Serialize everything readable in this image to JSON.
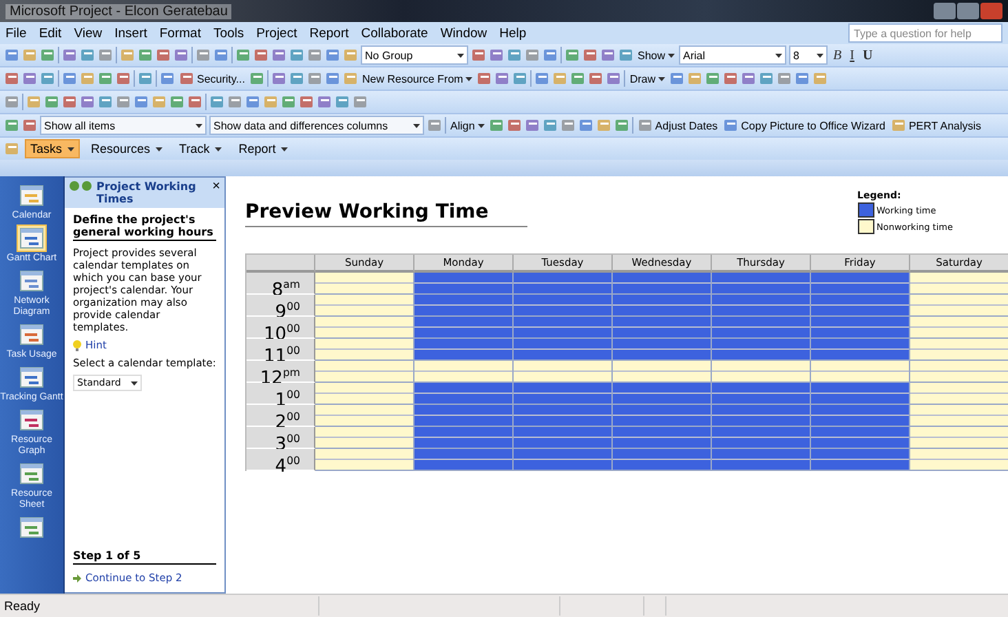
{
  "window": {
    "title": "Microsoft Project - Elcon Geratebau"
  },
  "menu": {
    "items": [
      "File",
      "Edit",
      "View",
      "Insert",
      "Format",
      "Tools",
      "Project",
      "Report",
      "Collaborate",
      "Window",
      "Help"
    ],
    "help_placeholder": "Type a question for help"
  },
  "toolbars": [
    [
      {
        "kind": "icon"
      },
      {
        "kind": "icon"
      },
      {
        "kind": "icon"
      },
      {
        "kind": "sep"
      },
      {
        "kind": "icon"
      },
      {
        "kind": "icon"
      },
      {
        "kind": "icon"
      },
      {
        "kind": "sep"
      },
      {
        "kind": "icon"
      },
      {
        "kind": "icon"
      },
      {
        "kind": "icon"
      },
      {
        "kind": "icon"
      },
      {
        "kind": "sep"
      },
      {
        "kind": "icon"
      },
      {
        "kind": "icon"
      },
      {
        "kind": "sep"
      },
      {
        "kind": "icon"
      },
      {
        "kind": "icon"
      },
      {
        "kind": "icon"
      },
      {
        "kind": "icon"
      },
      {
        "kind": "icon"
      },
      {
        "kind": "icon"
      },
      {
        "kind": "icon"
      },
      {
        "kind": "field",
        "text": "No Group"
      },
      {
        "kind": "icon"
      },
      {
        "kind": "icon"
      },
      {
        "kind": "icon"
      },
      {
        "kind": "icon"
      },
      {
        "kind": "icon"
      },
      {
        "kind": "sep"
      },
      {
        "kind": "icon"
      },
      {
        "kind": "icon"
      },
      {
        "kind": "icon"
      },
      {
        "kind": "icon"
      },
      {
        "kind": "menu",
        "text": "Show"
      },
      {
        "kind": "field",
        "text": "Arial"
      },
      {
        "kind": "small",
        "text": "8"
      },
      {
        "kind": "glyph",
        "text": "B"
      },
      {
        "kind": "glyph",
        "text": "I"
      },
      {
        "kind": "glyph",
        "text": "U"
      }
    ],
    [
      {
        "kind": "icon"
      },
      {
        "kind": "icon"
      },
      {
        "kind": "icon"
      },
      {
        "kind": "sep"
      },
      {
        "kind": "icon"
      },
      {
        "kind": "icon"
      },
      {
        "kind": "icon"
      },
      {
        "kind": "icon"
      },
      {
        "kind": "sep"
      },
      {
        "kind": "icon"
      },
      {
        "kind": "sep"
      },
      {
        "kind": "icon"
      },
      {
        "kind": "button",
        "text": "Security..."
      },
      {
        "kind": "icon"
      },
      {
        "kind": "sep"
      },
      {
        "kind": "icon"
      },
      {
        "kind": "icon"
      },
      {
        "kind": "icon"
      },
      {
        "kind": "icon"
      },
      {
        "kind": "icon"
      },
      {
        "kind": "menu",
        "text": "New Resource From"
      },
      {
        "kind": "icon"
      },
      {
        "kind": "icon"
      },
      {
        "kind": "icon"
      },
      {
        "kind": "sep"
      },
      {
        "kind": "icon"
      },
      {
        "kind": "icon"
      },
      {
        "kind": "icon"
      },
      {
        "kind": "icon"
      },
      {
        "kind": "icon"
      },
      {
        "kind": "sep"
      },
      {
        "kind": "menu",
        "text": "Draw"
      },
      {
        "kind": "icon"
      },
      {
        "kind": "icon"
      },
      {
        "kind": "icon"
      },
      {
        "kind": "icon"
      },
      {
        "kind": "icon"
      },
      {
        "kind": "icon"
      },
      {
        "kind": "icon"
      },
      {
        "kind": "icon"
      },
      {
        "kind": "icon"
      }
    ],
    [
      {
        "kind": "icon"
      },
      {
        "kind": "sep"
      },
      {
        "kind": "icon"
      },
      {
        "kind": "icon"
      },
      {
        "kind": "icon"
      },
      {
        "kind": "icon"
      },
      {
        "kind": "icon"
      },
      {
        "kind": "icon"
      },
      {
        "kind": "icon"
      },
      {
        "kind": "icon"
      },
      {
        "kind": "icon"
      },
      {
        "kind": "icon"
      },
      {
        "kind": "sep"
      },
      {
        "kind": "icon"
      },
      {
        "kind": "icon"
      },
      {
        "kind": "icon"
      },
      {
        "kind": "icon"
      },
      {
        "kind": "icon"
      },
      {
        "kind": "icon"
      },
      {
        "kind": "icon"
      },
      {
        "kind": "icon"
      },
      {
        "kind": "icon"
      }
    ],
    [
      {
        "kind": "icon"
      },
      {
        "kind": "icon"
      },
      {
        "kind": "wide",
        "text": "Show all items"
      },
      {
        "kind": "wide",
        "text": "Show data and differences columns"
      },
      {
        "kind": "icon"
      },
      {
        "kind": "sep"
      },
      {
        "kind": "menu",
        "text": "Align"
      },
      {
        "kind": "icon"
      },
      {
        "kind": "icon"
      },
      {
        "kind": "icon"
      },
      {
        "kind": "icon"
      },
      {
        "kind": "icon"
      },
      {
        "kind": "icon"
      },
      {
        "kind": "icon"
      },
      {
        "kind": "icon"
      },
      {
        "kind": "sep"
      },
      {
        "kind": "button",
        "text": "Adjust Dates"
      },
      {
        "kind": "button",
        "text": "Copy Picture to Office Wizard"
      },
      {
        "kind": "button",
        "text": "PERT Analysis"
      }
    ]
  ],
  "guide_bar": [
    {
      "label": "Tasks",
      "selected": true
    },
    {
      "label": "Resources",
      "selected": false
    },
    {
      "label": "Track",
      "selected": false
    },
    {
      "label": "Report",
      "selected": false
    }
  ],
  "views": [
    {
      "label": "Calendar",
      "selected": false
    },
    {
      "label": "Gantt Chart",
      "selected": true
    },
    {
      "label": "Network Diagram",
      "selected": false
    },
    {
      "label": "Task Usage",
      "selected": false
    },
    {
      "label": "Tracking Gantt",
      "selected": false
    },
    {
      "label": "Resource Graph",
      "selected": false
    },
    {
      "label": "Resource Sheet",
      "selected": false
    },
    {
      "selected": false
    }
  ],
  "task_pane": {
    "title": "Project Working Times",
    "close": "×",
    "heading": "Define the project's general working hours",
    "text": "Project provides several calendar templates on which you can base your project's calendar. Your organization may also provide calendar templates.",
    "hint": "Hint",
    "select_label": "Select a calendar template:",
    "template": "Standard",
    "step": "Step 1 of 5",
    "continue": "Continue to Step 2"
  },
  "preview": {
    "title": "Preview Working Time",
    "legend": {
      "title": "Legend:",
      "items": [
        {
          "label": "Working time",
          "color": "#3d62de"
        },
        {
          "label": "Nonworking time",
          "color": "#fff8cc"
        }
      ]
    },
    "days": [
      "Sunday",
      "Monday",
      "Tuesday",
      "Wednesday",
      "Thursday",
      "Friday",
      "Saturday"
    ],
    "rows": [
      {
        "time": "8$^{am}$",
        "working": [
          false,
          true,
          true,
          true,
          true,
          true,
          false
        ]
      },
      {
        "time": "9$^{00}$",
        "working": [
          false,
          true,
          true,
          true,
          true,
          true,
          false
        ]
      },
      {
        "time": "10$^{00}$",
        "working": [
          false,
          true,
          true,
          true,
          true,
          true,
          false
        ]
      },
      {
        "time": "11$^{00}$",
        "working": [
          false,
          true,
          true,
          true,
          true,
          true,
          false
        ]
      },
      {
        "time": "12$^{pm}$",
        "working": [
          false,
          false,
          false,
          false,
          false,
          false,
          false
        ]
      },
      {
        "time": "1$^{00}$",
        "working": [
          false,
          true,
          true,
          true,
          true,
          true,
          false
        ]
      },
      {
        "time": "2$^{00}$",
        "working": [
          false,
          true,
          true,
          true,
          true,
          true,
          false
        ]
      },
      {
        "time": "3$^{00}$",
        "working": [
          false,
          true,
          true,
          true,
          true,
          true,
          false
        ]
      },
      {
        "time": "4$^{00}$",
        "working": [
          false,
          true,
          true,
          true,
          true,
          true,
          false
        ]
      }
    ]
  },
  "status_bar": {
    "text": "Ready"
  }
}
